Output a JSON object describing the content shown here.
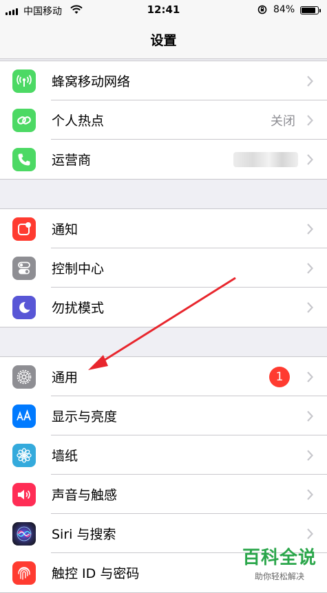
{
  "status_bar": {
    "carrier": "中国移动",
    "time": "12:41",
    "battery": "84%"
  },
  "nav": {
    "title": "设置"
  },
  "groups": [
    {
      "items": [
        {
          "label": "蜂窝移动网络",
          "icon": "cellular-antenna-icon",
          "color": "#4cd964"
        },
        {
          "label": "个人热点",
          "value": "关闭",
          "icon": "hotspot-link-icon",
          "color": "#4cd964"
        },
        {
          "label": "运营商",
          "icon": "phone-icon",
          "color": "#4cd964"
        }
      ]
    },
    {
      "items": [
        {
          "label": "通知",
          "icon": "notification-icon",
          "color": "#ff3b30"
        },
        {
          "label": "控制中心",
          "icon": "toggles-icon",
          "color": "#8e8e93"
        },
        {
          "label": "勿扰模式",
          "icon": "moon-icon",
          "color": "#5856d6"
        }
      ]
    },
    {
      "items": [
        {
          "label": "通用",
          "badge": "1",
          "icon": "gear-icon",
          "color": "#8e8e93"
        },
        {
          "label": "显示与亮度",
          "icon": "text-size-icon",
          "color": "#007aff"
        },
        {
          "label": "墙纸",
          "icon": "flower-icon",
          "color": "#34aadc"
        },
        {
          "label": "声音与触感",
          "icon": "speaker-icon",
          "color": "#ff2d55"
        },
        {
          "label": "Siri 与搜索",
          "icon": "siri-icon",
          "color": "#1c1c3c"
        },
        {
          "label": "触控 ID 与密码",
          "icon": "fingerprint-icon",
          "color": "#ff3b30"
        }
      ]
    }
  ],
  "watermark": {
    "title": "百科全说",
    "subtitle": "助你轻松解决"
  },
  "annotation": {
    "arrow_color": "#e8262d"
  }
}
